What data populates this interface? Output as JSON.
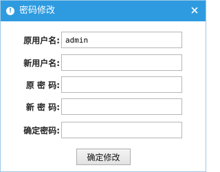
{
  "window": {
    "title": "密码修改",
    "title_icon": "info-icon",
    "close_icon": "close-icon",
    "accent_color": "#2e9be0"
  },
  "form": {
    "fields": [
      {
        "label": "原用户名:",
        "value": "admin"
      },
      {
        "label": "新用户名:",
        "value": ""
      },
      {
        "label": "原 密 码:",
        "value": ""
      },
      {
        "label": "新 密 码:",
        "value": ""
      },
      {
        "label": "确定密码:",
        "value": ""
      }
    ],
    "submit_label": "确定修改"
  }
}
